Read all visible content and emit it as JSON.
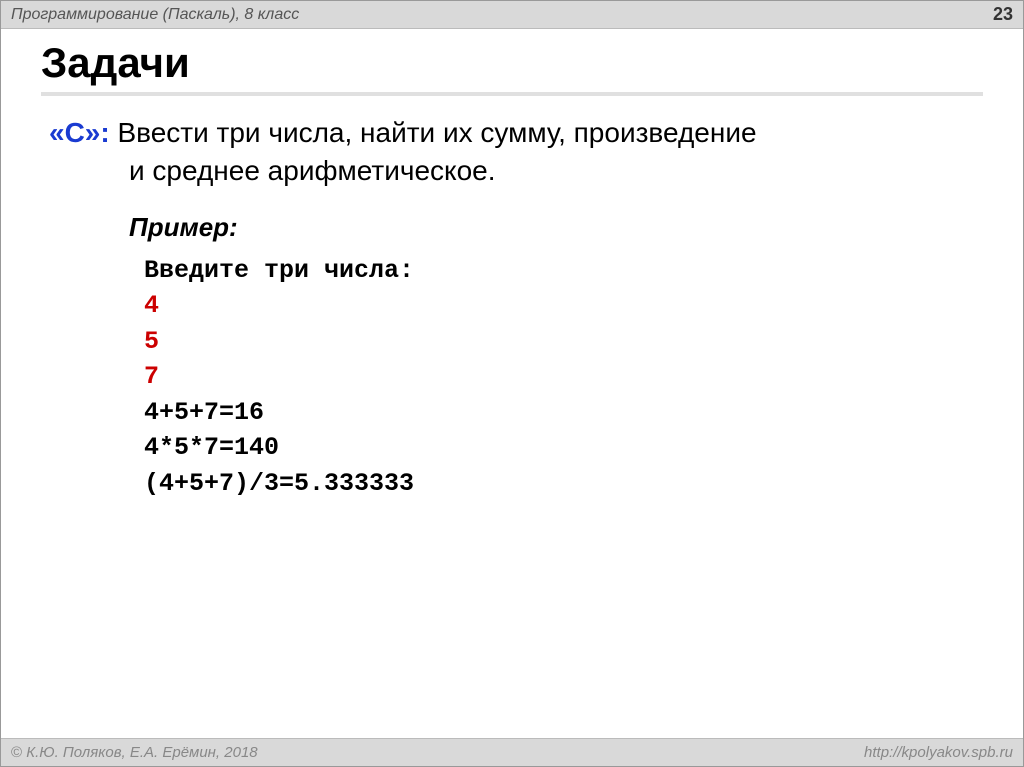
{
  "header": {
    "title": "Программирование (Паскаль), 8 класс",
    "page_number": "23"
  },
  "main_title": "Задачи",
  "task": {
    "label": "«C»:",
    "text_line1": " Ввести три числа, найти их сумму, произведение",
    "text_line2": "и среднее арифметическое."
  },
  "example_label": "Пример:",
  "code": {
    "prompt": "Введите три числа:",
    "input1": "4",
    "input2": "5",
    "input3": "7",
    "output1": "4+5+7=16",
    "output2": "4*5*7=140",
    "output3": "(4+5+7)/3=5.333333"
  },
  "footer": {
    "copyright_symbol": "©",
    "authors": " К.Ю. Поляков, Е.А. Ерёмин, 2018",
    "url": "http://kpolyakov.spb.ru"
  }
}
